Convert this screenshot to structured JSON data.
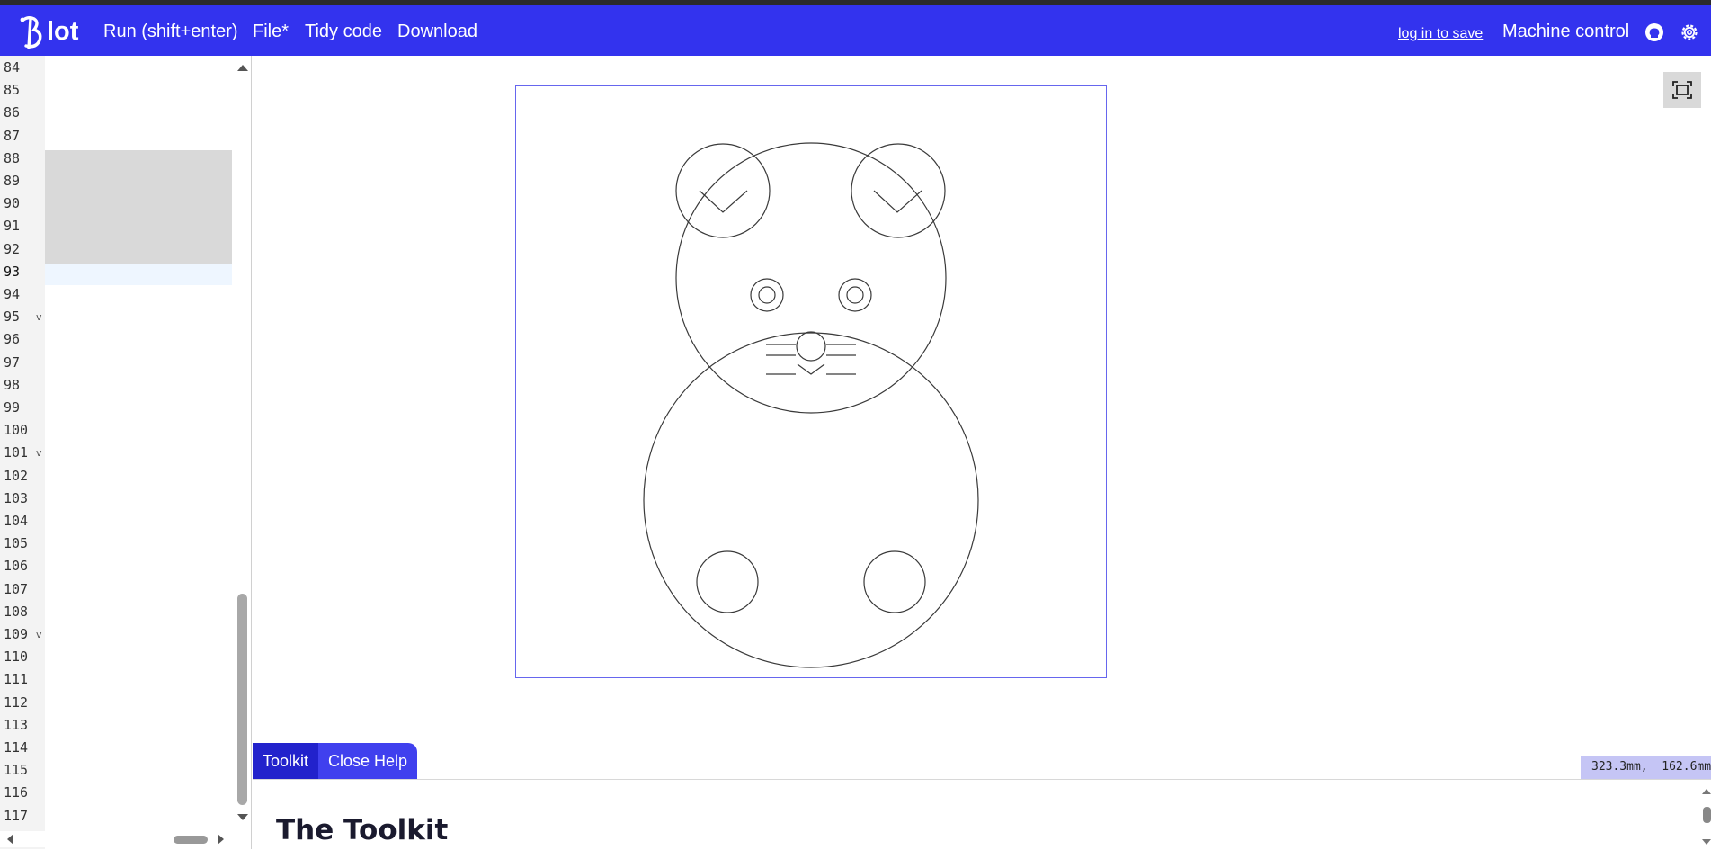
{
  "app": {
    "logo_text": "lot",
    "brand_color": "#3333ee"
  },
  "nav": {
    "run": "Run (shift+enter)",
    "file": "File*",
    "tidy": "Tidy code",
    "download": "Download",
    "login": "log in to save",
    "machine": "Machine control",
    "icons": [
      "github-icon",
      "gear-icon"
    ]
  },
  "editor": {
    "line_numbers": [
      "84",
      "85",
      "86",
      "87",
      "88",
      "89",
      "90",
      "91",
      "92",
      "93",
      "94",
      "95",
      "96",
      "97",
      "98",
      "99",
      "100",
      "101",
      "102",
      "103",
      "104",
      "105",
      "106",
      "107",
      "108",
      "109",
      "110",
      "111",
      "112",
      "113",
      "114",
      "115",
      "116",
      "117"
    ],
    "active_line": "93",
    "folded_lines": [
      "95",
      "101",
      "109"
    ],
    "fold_marker": "v"
  },
  "viewer": {
    "coords": "323.3mm,  162.6mm"
  },
  "help": {
    "tabs": [
      "Toolkit",
      "Close Help"
    ],
    "heading": "The Toolkit"
  }
}
